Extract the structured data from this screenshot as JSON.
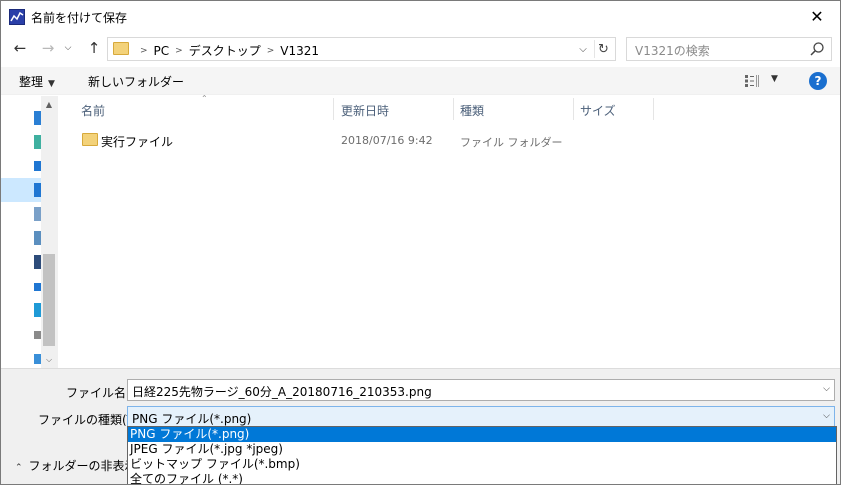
{
  "window": {
    "title": "名前を付けて保存"
  },
  "nav": {
    "back_icon": "arrow-left-icon",
    "forward_icon": "arrow-right-icon",
    "recent_icon": "chevron-down-icon",
    "up_icon": "arrow-up-icon"
  },
  "address": {
    "crumbs": [
      "PC",
      "デスクトップ",
      "V1321"
    ]
  },
  "search": {
    "placeholder": "V1321の検索"
  },
  "command_bar": {
    "organize_label": "整理",
    "new_folder_label": "新しいフォルダー"
  },
  "columns": {
    "name": "名前",
    "modified": "更新日時",
    "type": "種類",
    "size": "サイズ"
  },
  "files": [
    {
      "name": "実行ファイル",
      "modified": "2018/07/16 9:42",
      "type": "ファイル フォルダー"
    }
  ],
  "form": {
    "filename_label": "ファイル名(N):",
    "filename_value": "日経225先物ラージ_60分_A_20180716_210353.png",
    "filetype_label": "ファイルの種類(T):",
    "filetype_value": "PNG ファイル(*.png)"
  },
  "filetype_options": [
    "PNG ファイル(*.png)",
    "JPEG ファイル(*.jpg *jpeg)",
    "ビットマップ ファイル(*.bmp)",
    "全てのファイル (*.*)"
  ],
  "hide_folders_label": "フォルダーの非表示",
  "colors": {
    "selection": "#0078d7",
    "nav_selected": "#cce8ff",
    "folder": "#f3d27a",
    "help": "#1a6fcf"
  }
}
